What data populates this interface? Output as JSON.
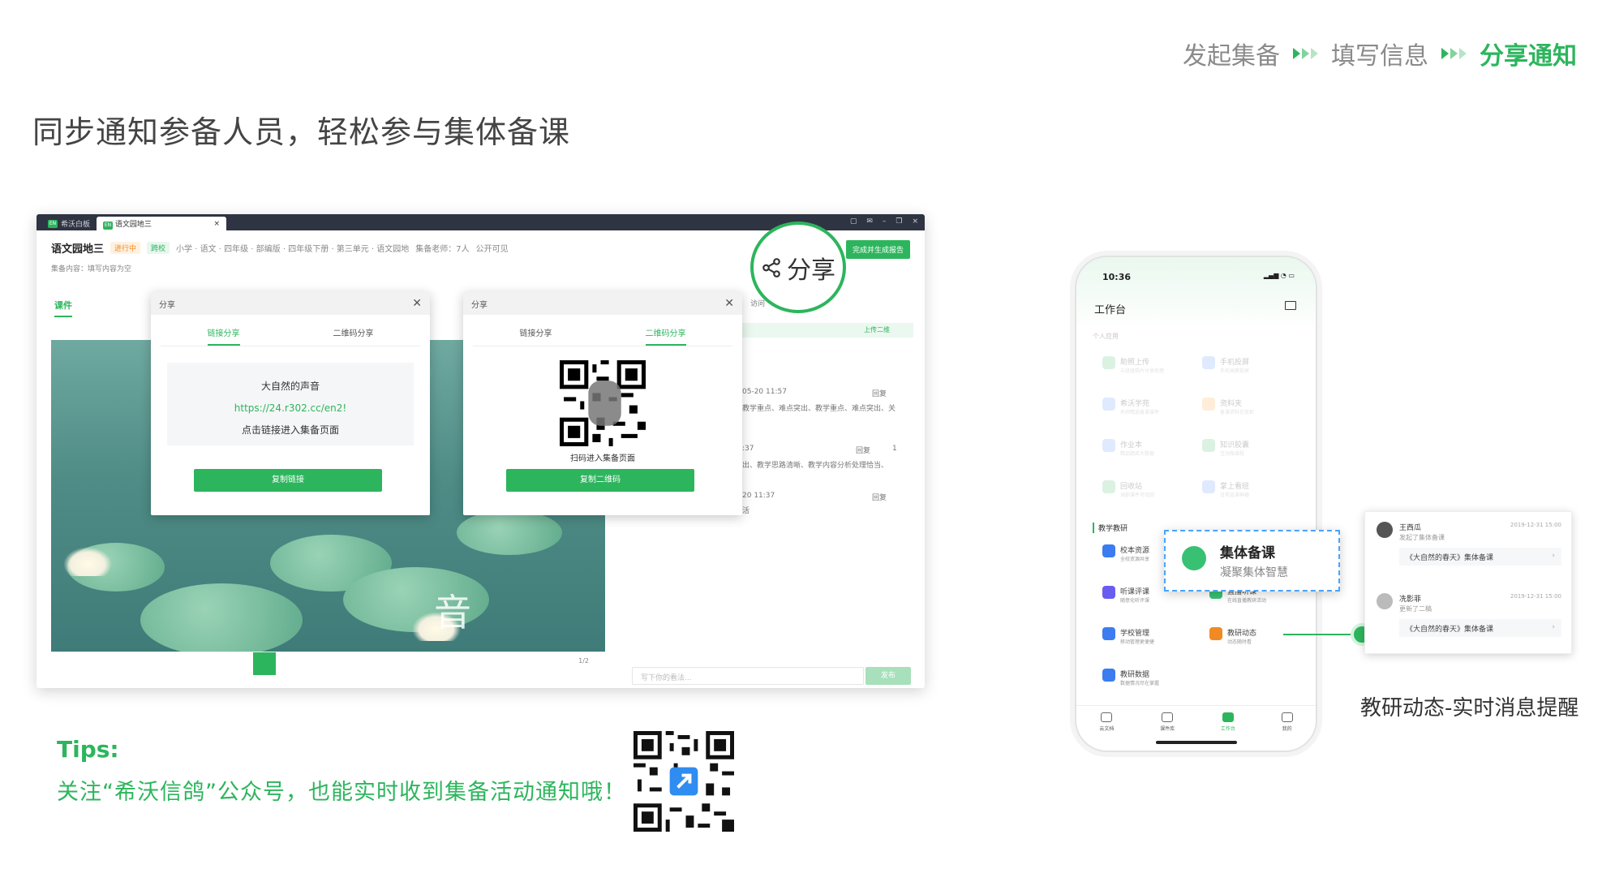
{
  "steps": [
    "发起集备",
    "填写信息",
    "分享通知"
  ],
  "headline": "同步通知参备人员，轻松参与集体备课",
  "window": {
    "tabs": [
      "希沃白板",
      "语文园地三"
    ],
    "title": "语文园地三",
    "status": "进行中",
    "scope": "跨校",
    "meta": "小学 · 语文 · 四年级 · 部编版 · 四年级下册 · 第三单元 · 语文园地",
    "teachers": "集备老师：7人",
    "visibility": "公开可见",
    "content_line": "集备内容：填写内容为空",
    "finish_button": "完成并生成报告",
    "tab_kejian": "课件",
    "visit_label": "访问",
    "upload_label": "上传二维",
    "pager": "1/2",
    "comment_placeholder": "写下你的看法...",
    "publish": "发布",
    "comments": [
      {
        "date": "05-20 11:57",
        "text": "教学重点、难点突出、教学重点、难点突出、关",
        "reply": "回复"
      },
      {
        "date": ":37",
        "text": "出、教学思路清晰、教学内容分析处理恰当、",
        "reply": "回复",
        "likes": "1"
      },
      {
        "date": "20 11:37",
        "text": "活",
        "reply": "回复"
      }
    ]
  },
  "link_dialog": {
    "title": "分享",
    "tabs": [
      "链接分享",
      "二维码分享"
    ],
    "name": "大自然的声音",
    "url": "https://24.r302.cc/en2!",
    "hint": "点击链接进入集备页面",
    "button": "复制链接"
  },
  "qr_dialog": {
    "title": "分享",
    "tabs": [
      "链接分享",
      "二维码分享"
    ],
    "hint": "扫码进入集备页面",
    "button": "复制二维码"
  },
  "share_callout": "分享",
  "tips": {
    "title": "Tips:",
    "body": "关注“希沃信鸽”公众号，也能实时收到集备活动通知哦！"
  },
  "phone": {
    "time": "10:36",
    "title": "工作台",
    "section_personal": "个人应用",
    "personal_items": [
      {
        "name": "助照上传",
        "sub": "与班级照片分享助理"
      },
      {
        "name": "手机投屏",
        "sub": "手机画面投屏"
      },
      {
        "name": "希沃学苑",
        "sub": "名师精选备课课件"
      },
      {
        "name": "资料夹",
        "sub": "备课资料存放柜"
      },
      {
        "name": "作业本",
        "sub": "精品题库大数据"
      },
      {
        "name": "知识胶囊",
        "sub": "互动微课程"
      },
      {
        "name": "回收站",
        "sub": "误删课件可找回"
      },
      {
        "name": "掌上看班",
        "sub": "日常巡课神器"
      }
    ],
    "section_teaching": "教学教研",
    "teaching_items": [
      {
        "name": "校本资源",
        "sub": "全校资源共享"
      },
      {
        "name": "听课评课",
        "sub": "随意化听评课"
      },
      {
        "name": "直播听课",
        "sub": "在线直播教研活动"
      },
      {
        "name": "学校管理",
        "sub": "移动管理更便捷"
      },
      {
        "name": "教研动态",
        "sub": "动态随时看"
      },
      {
        "name": "教研数据",
        "sub": "数据情况尽在掌握"
      }
    ],
    "nav": [
      "云文档",
      "课件库",
      "工作台",
      "我的"
    ]
  },
  "popout": {
    "title": "集体备课",
    "subtitle": "凝聚集体智慧"
  },
  "notifications": [
    {
      "name": "王西瓜",
      "action": "发起了集体备课",
      "date": "2019-12-31 15:00",
      "card": "《大自然的春天》集体备课"
    },
    {
      "name": "冼影菲",
      "action": "更新了二稿",
      "date": "2019-12-31 15:00",
      "card": "《大自然的春天》集体备课"
    }
  ],
  "caption": "教研动态-实时消息提醒",
  "colors": {
    "accent": "#2db55d",
    "dashed": "#4aa3ff"
  }
}
